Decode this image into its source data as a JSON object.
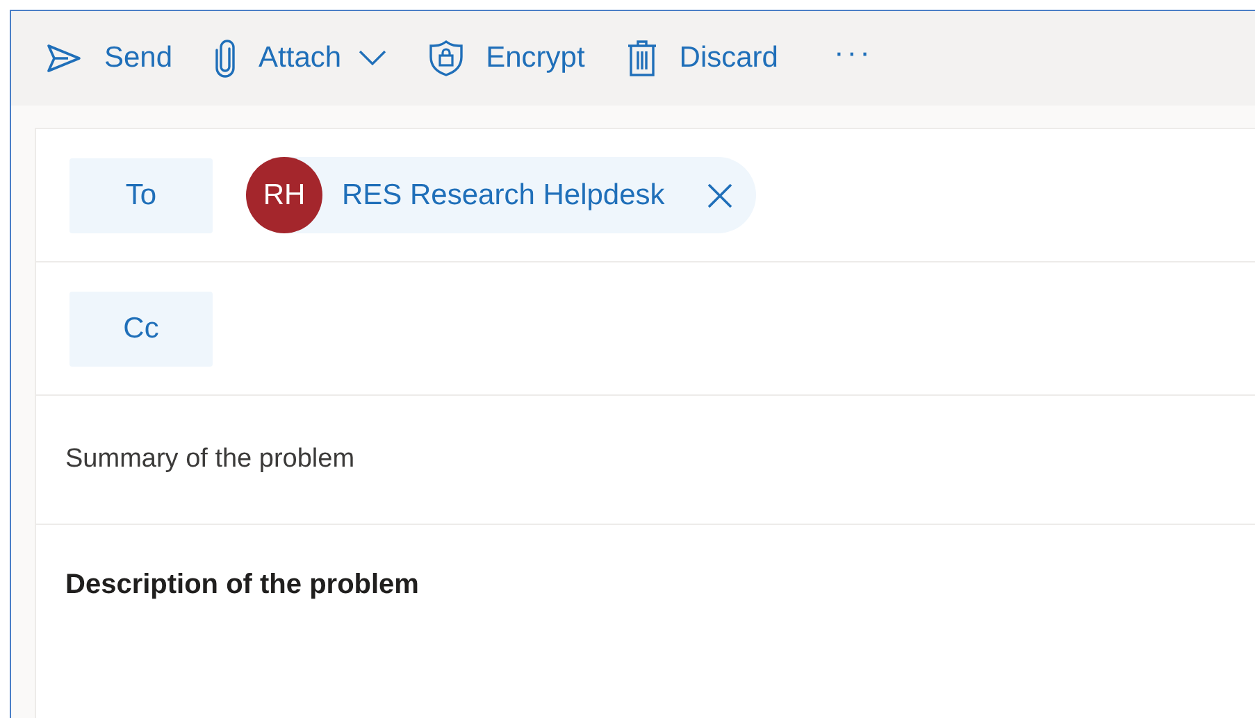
{
  "toolbar": {
    "actions": [
      {
        "kind": "send",
        "label": "Send"
      },
      {
        "kind": "attach",
        "label": "Attach",
        "dropdown": true
      },
      {
        "kind": "encrypt",
        "label": "Encrypt"
      },
      {
        "kind": "discard",
        "label": "Discard"
      }
    ],
    "more": "···"
  },
  "recipients": [
    {
      "label": "To",
      "chips": [
        {
          "initials": "RH",
          "name": "RES Research Helpdesk"
        }
      ]
    },
    {
      "label": "Cc"
    }
  ],
  "subject": {
    "value": "Summary of the problem"
  },
  "body": {
    "text": "Description of the problem"
  }
}
